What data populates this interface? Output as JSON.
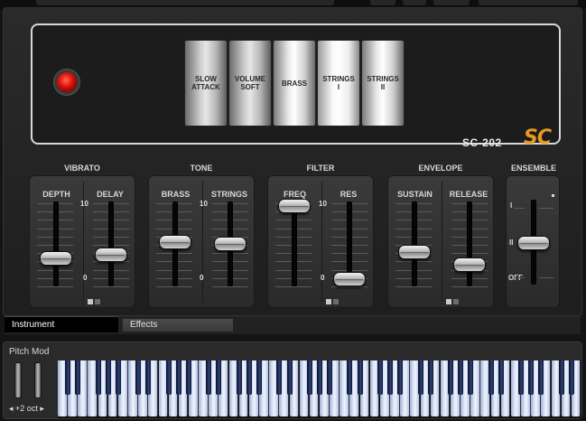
{
  "presets": [
    {
      "label": "SLOW\nATTACK"
    },
    {
      "label": "VOLUME\nSOFT"
    },
    {
      "label": "BRASS"
    },
    {
      "label": "STRINGS\nI"
    },
    {
      "label": "STRINGS\nII"
    }
  ],
  "model": "SC-202",
  "logo": "SC",
  "sections": {
    "vibrato": {
      "title": "VIBRATO",
      "depth": "DEPTH",
      "delay": "DELAY"
    },
    "tone": {
      "title": "TONE",
      "brass": "BRASS",
      "strings": "STRINGS"
    },
    "filter": {
      "title": "FILTER",
      "freq": "FREQ",
      "res": "RES"
    },
    "envelope": {
      "title": "ENVELOPE",
      "sustain": "SUSTAIN",
      "release": "RELEASE"
    },
    "ensemble": {
      "title": "ENSEMBLE",
      "pos1": "I",
      "pos2": "II",
      "off": "OFF"
    }
  },
  "scale": {
    "max": "10",
    "min": "0"
  },
  "slider_levels": {
    "depth": 0.3,
    "delay": 0.35,
    "brass": 0.5,
    "strings": 0.48,
    "freq": 0.95,
    "res": 0.05,
    "sustain": 0.38,
    "release": 0.22,
    "ensemble": "II"
  },
  "tabs": {
    "instrument": "Instrument",
    "effects": "Effects"
  },
  "bottom": {
    "pitch_mod": "Pitch Mod",
    "octave": "+2 oct"
  },
  "colors": {
    "accent": "#e79a1e",
    "led": "#e0140a",
    "keys_white": "#dde6f8",
    "keys_black": "#1f2e5a"
  }
}
